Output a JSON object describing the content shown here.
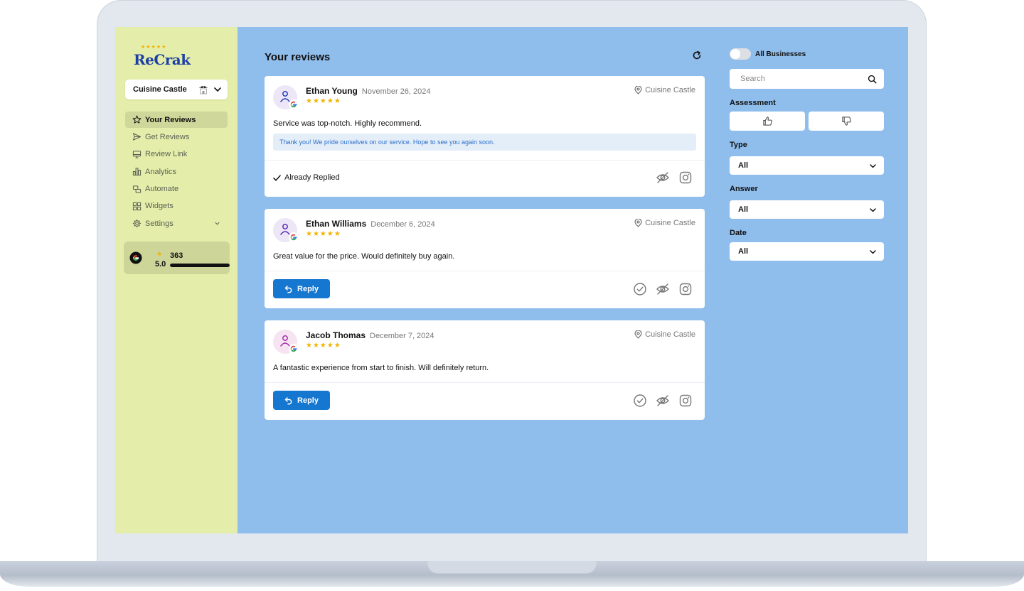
{
  "app": {
    "logo_text": "ReCrak",
    "logo_stars": "★★★★★"
  },
  "business_selector": {
    "value": "Cuisine Castle"
  },
  "sidebar": {
    "items": [
      {
        "label": "Your Reviews"
      },
      {
        "label": "Get Reviews"
      },
      {
        "label": "Review Link"
      },
      {
        "label": "Analytics"
      },
      {
        "label": "Automate"
      },
      {
        "label": "Widgets"
      },
      {
        "label": "Settings"
      }
    ],
    "rating": {
      "score": "5.0",
      "count": "363",
      "star": "★",
      "bar_fraction": 1.0
    }
  },
  "main": {
    "title": "Your reviews"
  },
  "reviews": [
    {
      "name": "Ethan Young",
      "date": "November 26, 2024",
      "stars": "★★★★★",
      "location": "Cuisine Castle",
      "text": "Service was top-notch. Highly recommend.",
      "reply": "Thank you! We pride ourselves on our service. Hope to see you again soon.",
      "status": "Already Replied"
    },
    {
      "name": "Ethan Williams",
      "date": "December 6, 2024",
      "stars": "★★★★★",
      "location": "Cuisine Castle",
      "text": "Great value for the price. Would definitely buy again.",
      "button": "Reply"
    },
    {
      "name": "Jacob Thomas",
      "date": "December 7, 2024",
      "stars": "★★★★★",
      "location": "Cuisine Castle",
      "text": "A fantastic experience from start to finish. Will definitely return.",
      "button": "Reply"
    }
  ],
  "filters": {
    "toggle_label": "All Businesses",
    "toggle_on": false,
    "search_placeholder": "Search",
    "assessment_label": "Assessment",
    "type_label": "Type",
    "type_value": "All",
    "answer_label": "Answer",
    "answer_value": "All",
    "date_label": "Date",
    "date_value": "All"
  },
  "colors": {
    "sidebar_bg": "#e4eeaa",
    "main_bg": "#8fbdec",
    "accent": "#1677d0",
    "star": "#f0b400",
    "brand": "#1d3fa8"
  }
}
